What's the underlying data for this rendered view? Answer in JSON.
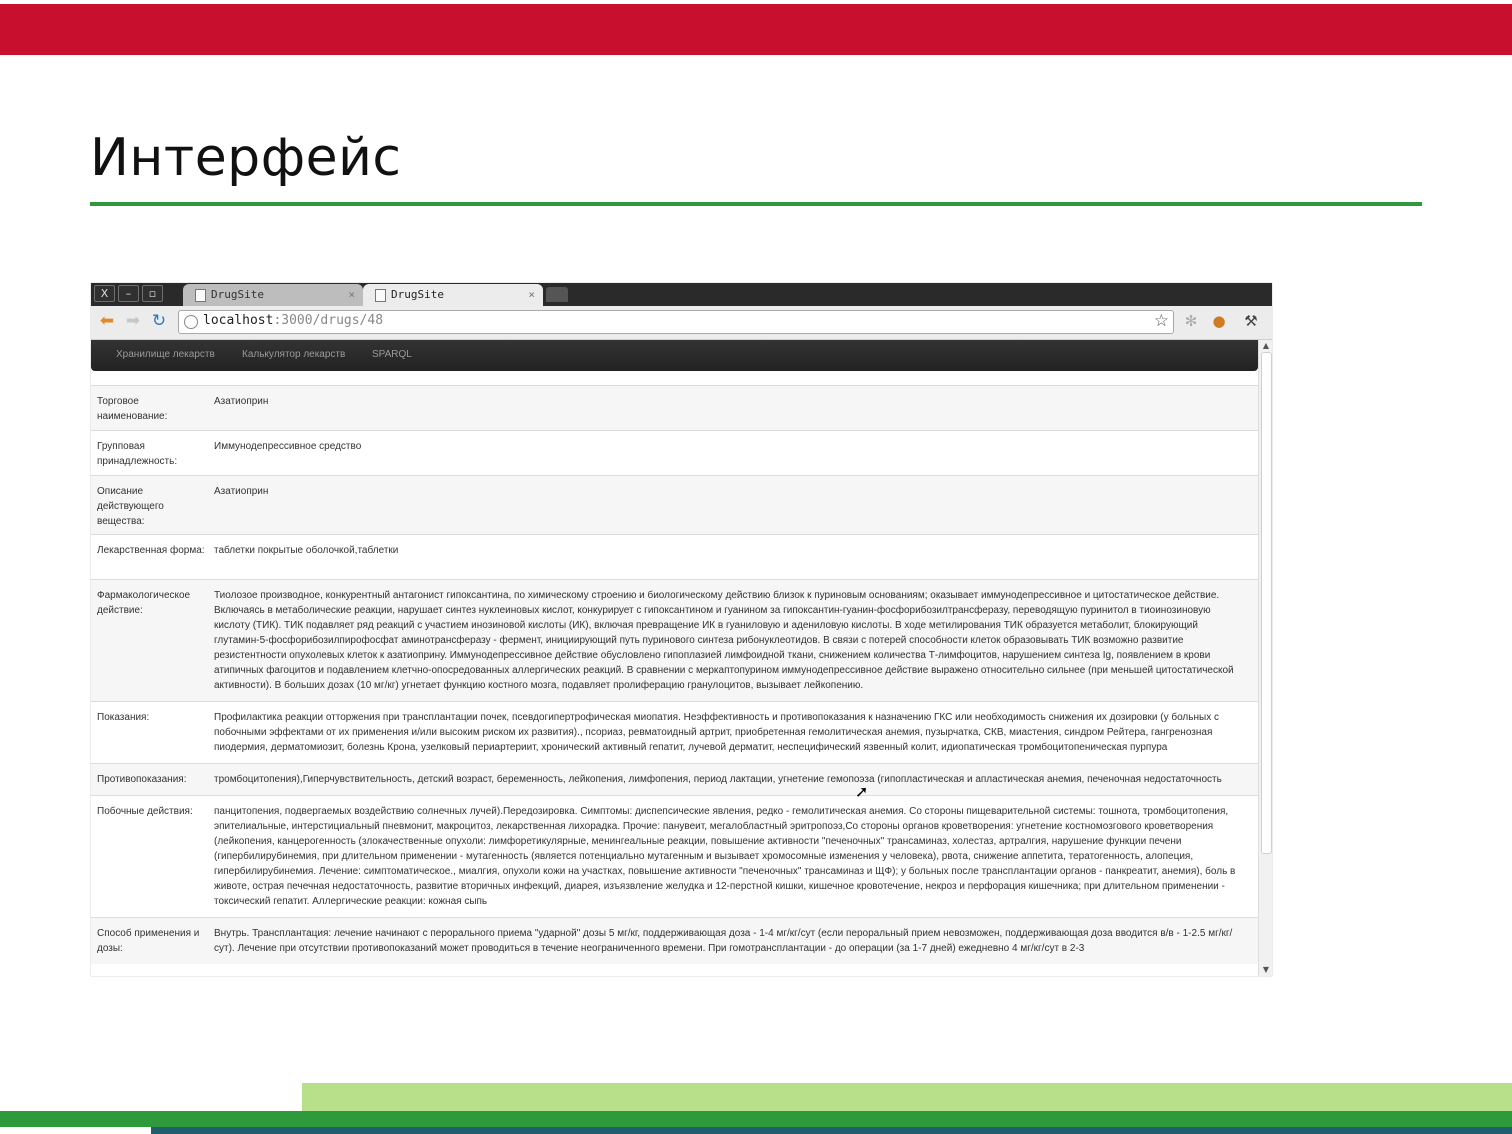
{
  "slide": {
    "title": "Интерфейс"
  },
  "browser": {
    "tabs": [
      {
        "label": "DrugSite",
        "close": "×"
      },
      {
        "label": "DrugSite",
        "close": "×"
      }
    ],
    "url_host": "localhost",
    "url_path": ":3000/drugs/48",
    "window_buttons": [
      "X",
      "–",
      "▫"
    ]
  },
  "nav": {
    "links": [
      "Хранилище лекарств",
      "Калькулятор лекарств",
      "SPARQL"
    ]
  },
  "drug": {
    "rows": [
      {
        "label": "Торговое наименование:",
        "value": "Азатиоприн"
      },
      {
        "label": "Групповая принадлежность:",
        "value": "Иммунодепрессивное средство"
      },
      {
        "label": "Описание действующего вещества:",
        "value": "Азатиоприн"
      },
      {
        "label": "Лекарственная форма:",
        "value": "таблетки покрытые оболочкой,таблетки"
      },
      {
        "label": "Фармакологическое действие:",
        "value": "Тиолозое производное, конкурентный антагонист гипоксантина, по химическому строению и биологическому действию близок к пуриновым основаниям; оказывает иммунодепрессивное и цитостатическое действие. Включаясь в метаболические реакции, нарушает синтез нуклеиновых кислот, конкурирует с гипоксантином и гуанином за гипоксантин-гуанин-фосфорибозилтрансферазу, переводящую пуринитол в тиоинозиновую кислоту (ТИК). ТИК подавляет ряд реакций с участием инозиновой кислоты (ИК), включая превращение ИК в гуаниловую и адениловую кислоты. В ходе метилирования ТИК образуется метаболит, блокирующий глутамин-5-фосфорибозилпирофосфат аминотрансферазу - фермент, инициирующий путь пуринового синтеза рибонуклеотидов. В связи с потерей способности клеток образовывать ТИК возможно развитие резистентности опухолевых клеток к азатиоприну. Иммунодепрессивное действие обусловлено гипоплазией лимфоидной ткани, снижением количества Т-лимфоцитов, нарушением синтеза Ig, появлением в крови атипичных фагоцитов и подавлением клетчно-опосредованных аллергических реакций. В сравнении с меркаптопурином иммунодепрессивное действие выражено относительно сильнее (при меньшей цитостатической активности). В больших дозах (10 мг/кг) угнетает функцию костного мозга, подавляет пролиферацию гранулоцитов, вызывает лейкопению."
      },
      {
        "label": "Показания:",
        "value": "Профилактика реакции отторжения при трансплантации почек, псевдогипертрофическая миопатия. Неэффективность и противопоказания к назначению ГКС или необходимость снижения их дозировки (у больных с побочными эффектами от их применения и/или высоким риском их развития)., псориаз, ревматоидный артрит, приобретенная гемолитическая анемия, пузырчатка, СКВ, миастения, синдром Рейтера, гангренозная пиодермия, дерматомиозит, болезнь Крона, узелковый периартериит, хронический активный гепатит, лучевой дерматит, неспецифический язвенный колит, идиопатическая тромбоцитопеническая пурпура"
      },
      {
        "label": "Противопоказания:",
        "value": "тромбоцитопения),Гиперчувствительность, детский возраст, беременность, лейкопения, лимфопения, период лактации, угнетение гемопоэза (гипопластическая и апластическая анемия, печеночная недостаточность"
      },
      {
        "label": "Побочные действия:",
        "value": "панцитопения, подвергаемых воздействию солнечных лучей).Передозировка. Симптомы: диспепсические явления, редко - гемолитическая анемия. Со стороны пищеварительной системы: тошнота, тромбоцитопения, эпителиальные, интерстициальный пневмонит, макроцитоз, лекарственная лихорадка. Прочие: панувеит, мегалобластный эритропоэз,Со стороны органов кроветворения: угнетение костномозгового кроветворения (лейкопения, канцерогенность (злокачественные опухоли: лимфоретикулярные, менингеальные реакции, повышение активности \"печеночных\" трансаминаз, холестаз, артралгия, нарушение функции печени (гипербилирубинемия, при длительном применении - мутагенность (является потенциально мутагенным и вызывает хромосомные изменения у человека), рвота, снижение аппетита, тератогенность, алопеция, гипербилирубинемия. Лечение: симптоматическое., миалгия, опухоли кожи на участках, повышение активности \"печеночных\" трансаминаз и ЩФ); у больных после трансплантации органов - панкреатит, анемия), боль в животе, острая печечная недостаточность, развитие вторичных инфекций, диарея, изъязвление желудка и 12-перстной кишки, кишечное кровотечение, некроз и перфорация кишечника; при длительном применении - токсический гепатит. Аллергические реакции: кожная сыпь"
      },
      {
        "label": "Способ применения и дозы:",
        "value": "Внутрь. Трансплантация: лечение начинают с перорального приема \"ударной\" дозы 5 мг/кг, поддерживающая доза - 1-4 мг/кг/сут (если пероральный прием невозможен, поддерживающая доза вводится в/в - 1-2.5 мг/кг/сут). Лечение при отсутствии противопоказаний может проводиться в течение неограниченного времени. При гомотрансплантации - до операции (за 1-7 дней) ежедневно 4 мг/кг/сут в 2-3"
      }
    ]
  },
  "colors": {
    "brand_red": "#c8102e",
    "brand_green": "#2e9a3b",
    "light_green": "#b8e08a",
    "navbar": "#222222"
  }
}
